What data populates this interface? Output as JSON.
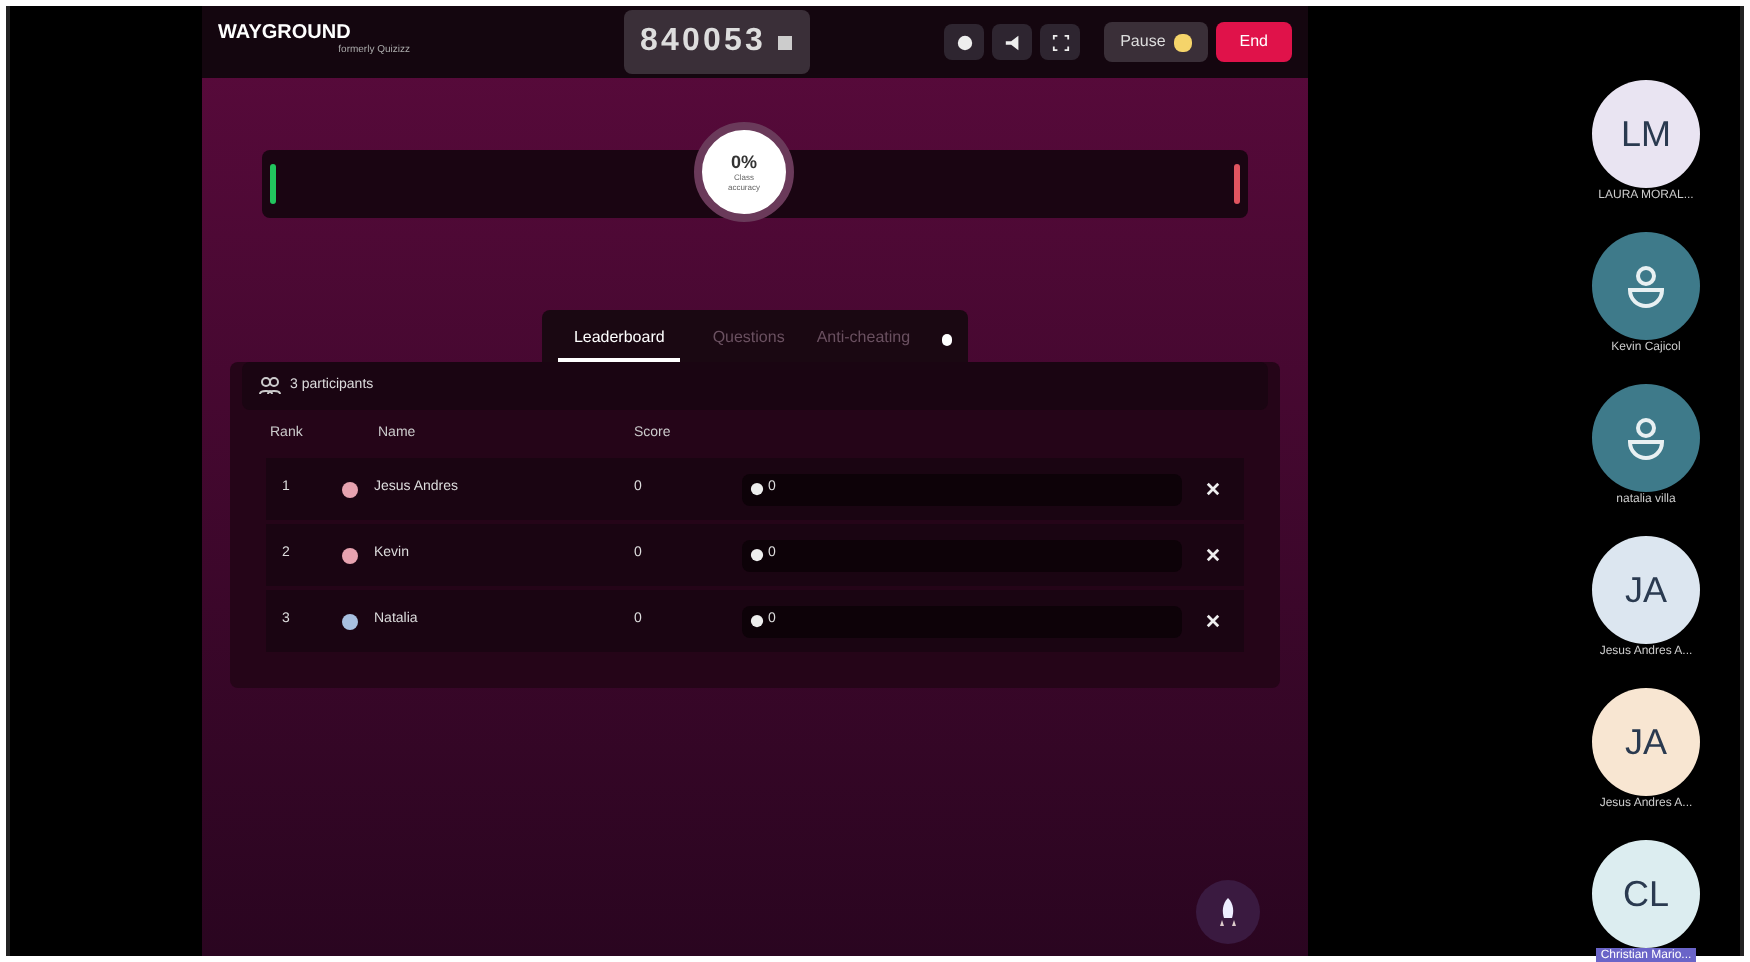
{
  "header": {
    "logo": "WAYGROUND",
    "logo_sub": "formerly Quizizz",
    "code": "840053",
    "pause": "Pause",
    "end": "End"
  },
  "accuracy": {
    "value": "0%",
    "label": "Class accuracy"
  },
  "tabs": [
    {
      "label": "Leaderboard",
      "selected": true
    },
    {
      "label": "Questions",
      "selected": false
    },
    {
      "label": "Anti-cheating",
      "selected": false
    }
  ],
  "participants_count": "3 participants",
  "columns": [
    "Rank",
    "Name",
    "Score"
  ],
  "rows": [
    {
      "rank": "1",
      "name": "Jesus Andres",
      "score": "0",
      "streak": "0",
      "color": "#e7a3b0"
    },
    {
      "rank": "2",
      "name": "Kevin",
      "score": "0",
      "streak": "0",
      "color": "#e7a3b0"
    },
    {
      "rank": "3",
      "name": "Natalia",
      "score": "0",
      "streak": "0",
      "color": "#a8c0e0"
    }
  ],
  "call_participants": [
    {
      "initials": "LM",
      "name": "LAURA MORAL...",
      "kind": "initials",
      "color": "#e9e4f2",
      "highlighted": false
    },
    {
      "name": "Kevin Cajicol",
      "kind": "person",
      "color": "#3e7a8a",
      "highlighted": false
    },
    {
      "name": "natalia villa",
      "kind": "person",
      "color": "#3e7a8a",
      "highlighted": false
    },
    {
      "initials": "JA",
      "name": "Jesus Andres A...",
      "kind": "initials",
      "color": "#dce6f0",
      "highlighted": false
    },
    {
      "initials": "JA",
      "name": "Jesus Andres A...",
      "kind": "initials",
      "color": "#f8e6d2",
      "highlighted": false
    },
    {
      "initials": "CL",
      "name": "Christian Mario...",
      "kind": "initials",
      "color": "#dcedf0",
      "highlighted": true
    }
  ]
}
